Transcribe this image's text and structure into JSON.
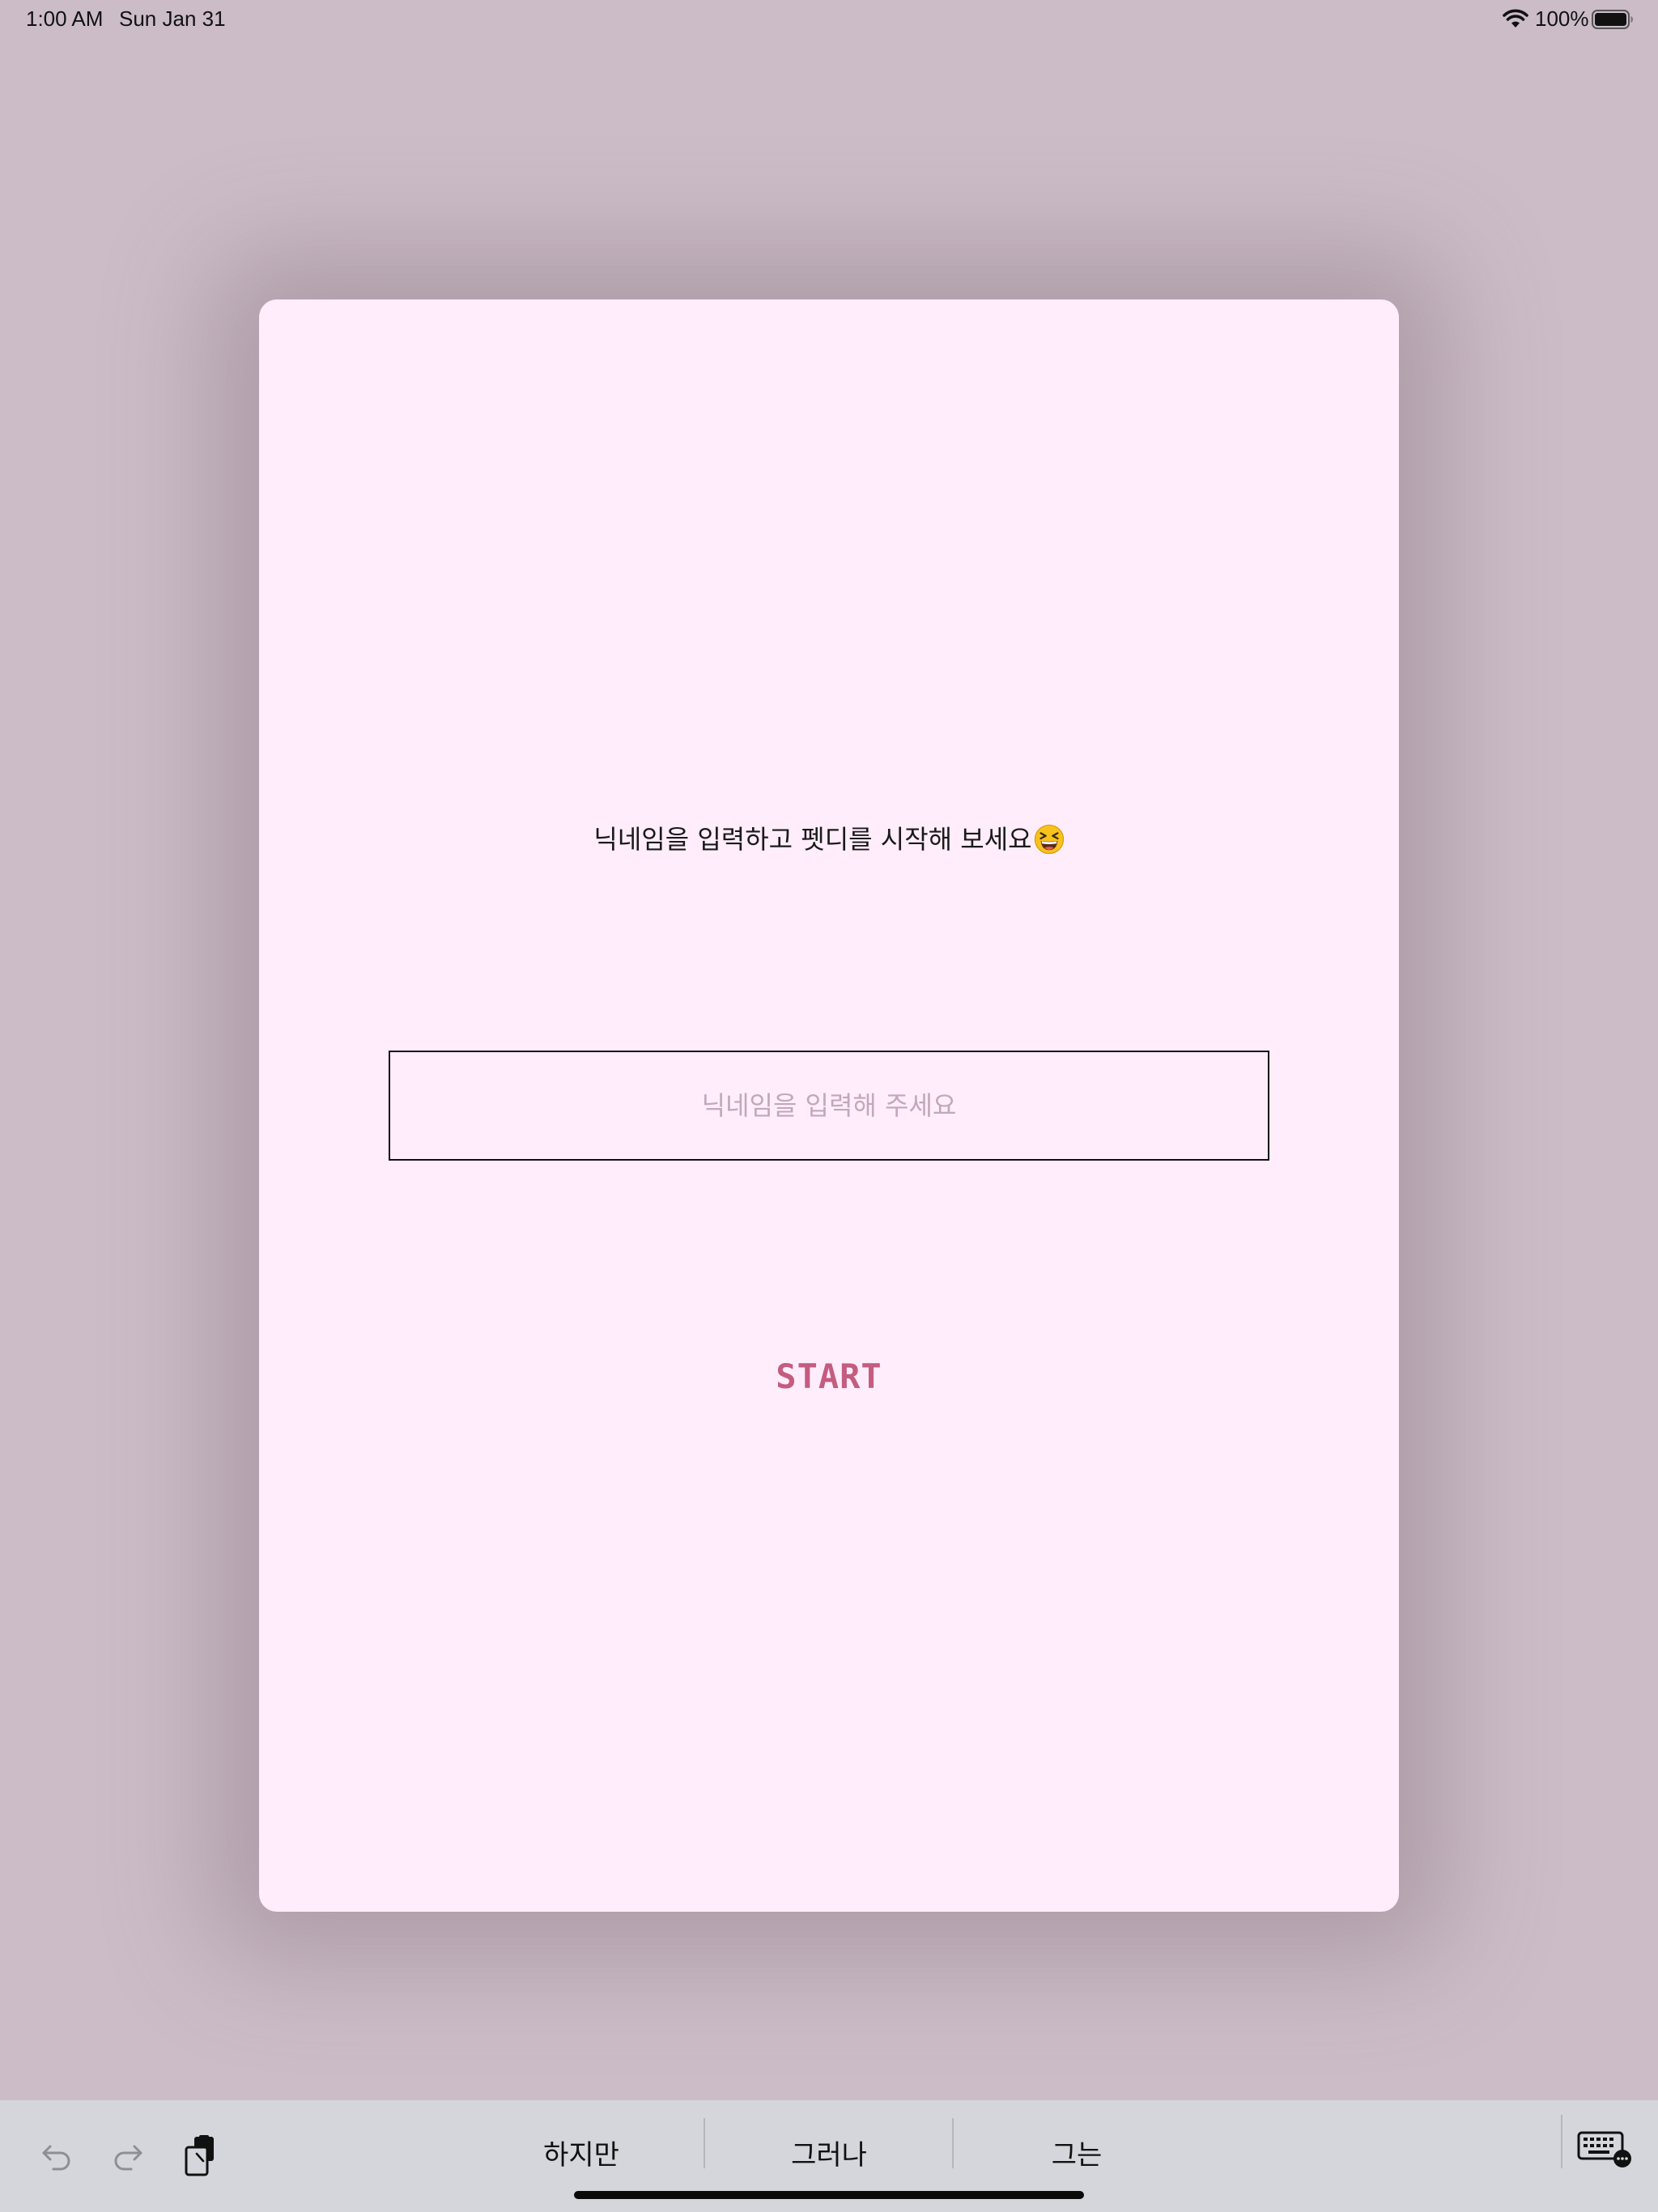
{
  "status_bar": {
    "time": "1:00 AM",
    "date": "Sun Jan 31",
    "battery_percent": "100%",
    "battery_level": 1.0,
    "icons": [
      "wifi-icon",
      "battery-icon"
    ]
  },
  "card": {
    "prompt": "닉네임을 입력하고 펫디를 시작해 보세요",
    "prompt_emoji": "grinning-squinting-face-emoji",
    "nickname_input": {
      "value": "",
      "placeholder": "닉네임을 입력해 주세요"
    },
    "start_label": "START"
  },
  "keyboard_bar": {
    "icons": [
      "undo-icon",
      "redo-icon",
      "paste-icon",
      "keyboard-icon"
    ],
    "suggestions": [
      "하지만",
      "그러나",
      "그는"
    ]
  },
  "colors": {
    "background": "#cbbcc7",
    "card_background": "#ffedfb",
    "start_accent": "#c45c80",
    "placeholder": "#c2a8b8",
    "keyboard_bar": "#d5d6db"
  }
}
